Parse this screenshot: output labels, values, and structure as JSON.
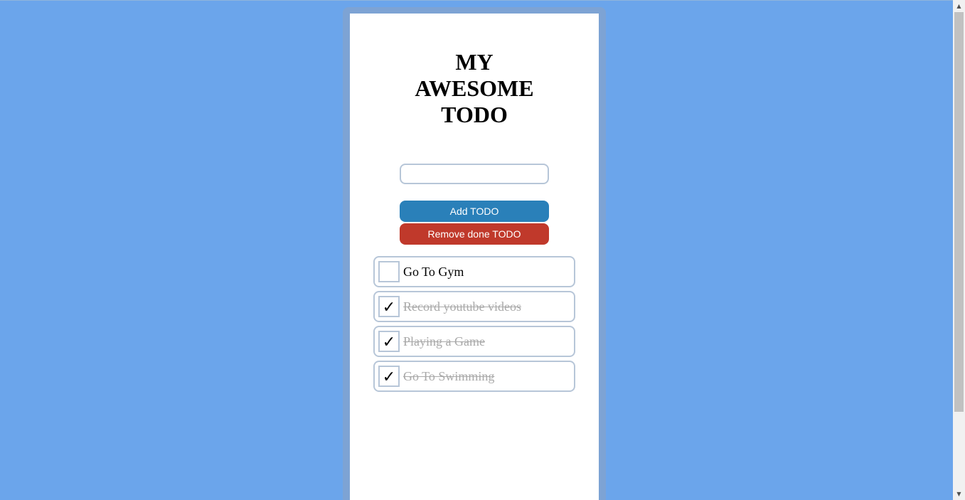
{
  "app": {
    "title": "MY\nAWESOME\nTODO"
  },
  "form": {
    "input_value": "",
    "input_placeholder": "",
    "add_label": "Add TODO",
    "remove_label": "Remove done TODO"
  },
  "todos": [
    {
      "text": "Go To Gym",
      "done": false
    },
    {
      "text": "Record youtube videos",
      "done": true
    },
    {
      "text": "Playing a Game",
      "done": true
    },
    {
      "text": "Go To Swimming",
      "done": true
    }
  ],
  "check_glyph": "✓",
  "colors": {
    "background": "#6ba5eb",
    "frame": "#7da3d4",
    "add_button": "#2a80b9",
    "remove_button": "#c0392b",
    "done_text": "#a9a9a9",
    "border": "#b7c6d8"
  },
  "icons": {
    "scroll_up": "triangle-up",
    "scroll_down": "triangle-down"
  }
}
